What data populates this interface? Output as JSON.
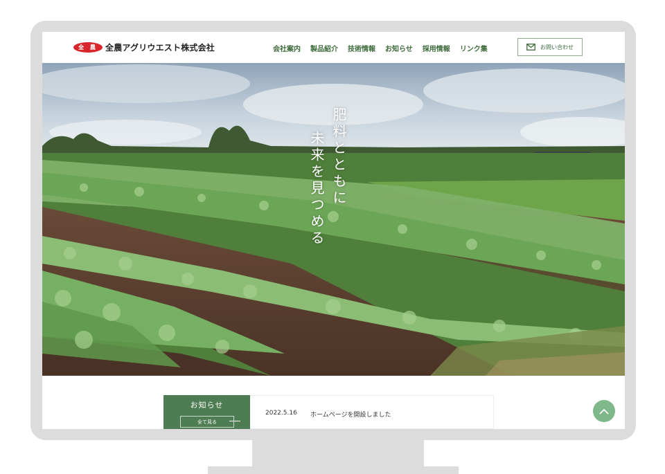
{
  "header": {
    "logo_mark": "全 農",
    "logo_text": "全農アグリウエスト株式会社",
    "nav": [
      "会社案内",
      "製品紹介",
      "技術情報",
      "お知らせ",
      "採用情報",
      "リンク集"
    ],
    "contact_label": "お問い合わせ"
  },
  "hero": {
    "tagline_line1": "肥料とともに",
    "tagline_line2": "未来を見つめる"
  },
  "news": {
    "title": "お知らせ",
    "all_label": "全て見る",
    "items": [
      {
        "date": "2022.5.16",
        "text": "ホームページを開設しました"
      }
    ]
  },
  "colors": {
    "brand_green": "#4f7d53",
    "logo_red": "#d8262c",
    "to_top_green": "#7fb88a"
  }
}
